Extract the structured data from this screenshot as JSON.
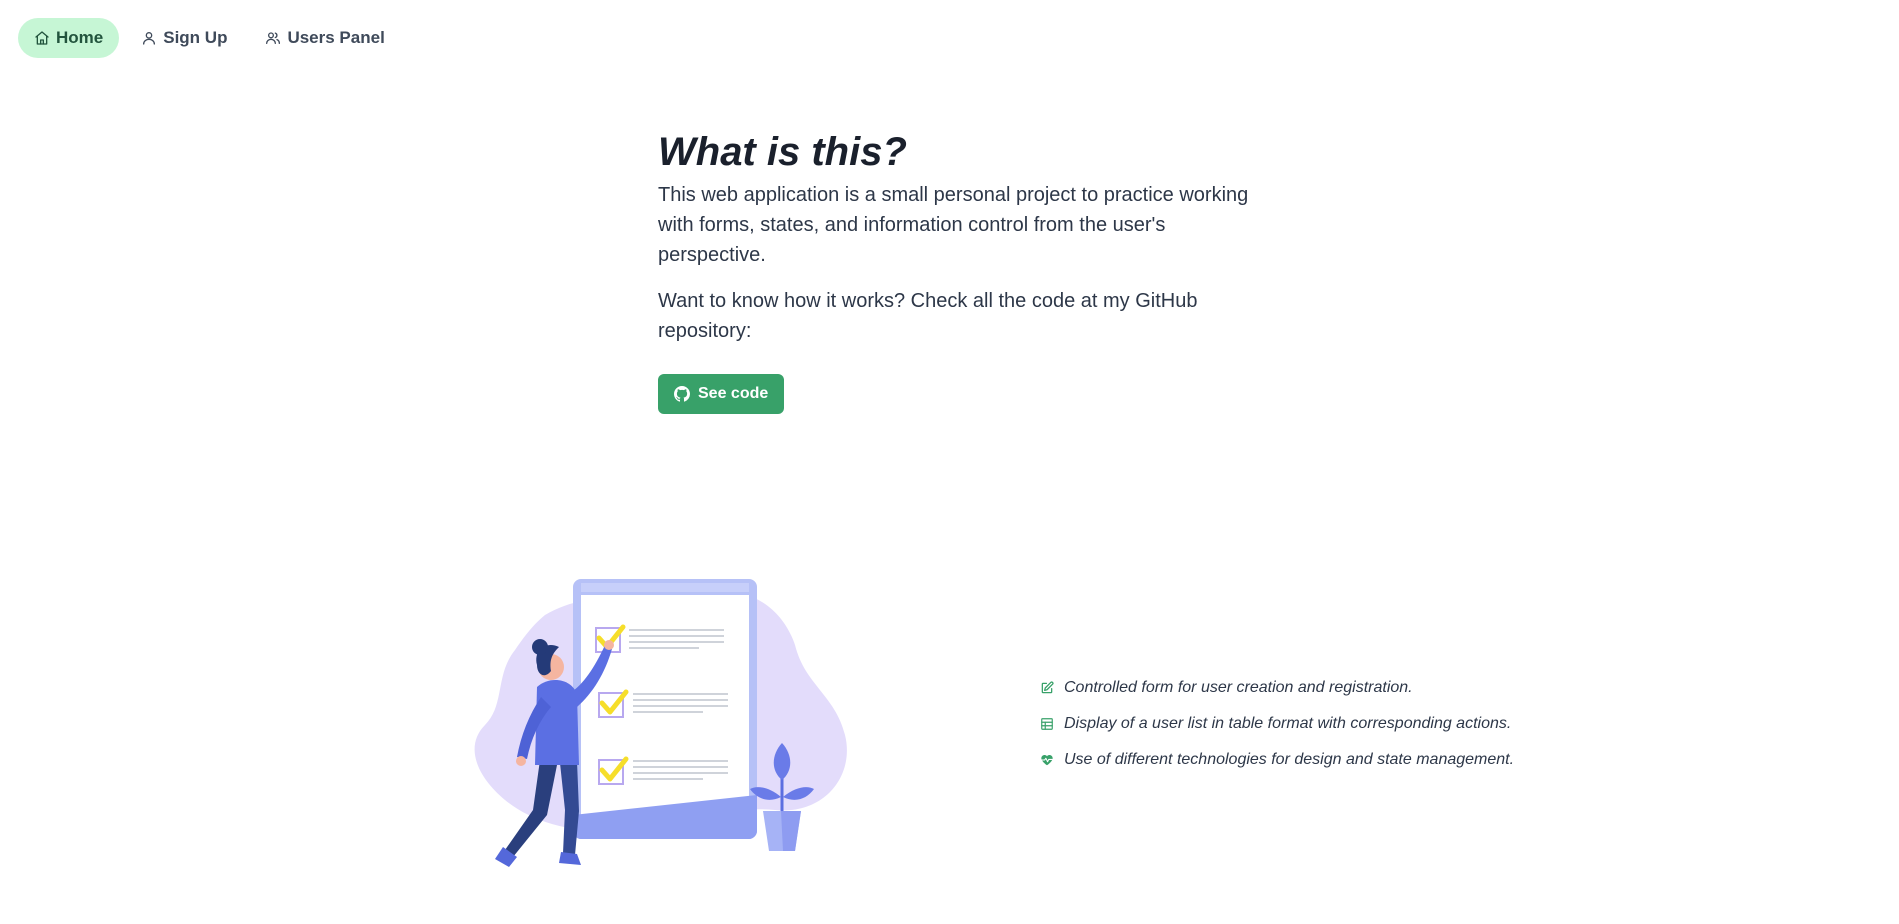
{
  "nav": {
    "items": [
      {
        "label": "Home",
        "icon": "home-icon",
        "active": true
      },
      {
        "label": "Sign Up",
        "icon": "user-icon",
        "active": false
      },
      {
        "label": "Users Panel",
        "icon": "users-icon",
        "active": false
      }
    ]
  },
  "intro": {
    "title": "What is this?",
    "paragraph1": "This web application is a small personal project to practice working with forms, states, and information control from the user's perspective.",
    "paragraph2": "Want to know how it works? Check all the code at my GitHub repository:",
    "button_label": "See code",
    "button_icon": "github-icon"
  },
  "features": [
    {
      "icon": "edit-icon",
      "text": "Controlled form for user creation and registration."
    },
    {
      "icon": "table-icon",
      "text": "Display of a user list in table format with corresponding actions."
    },
    {
      "icon": "heart-icon",
      "text": "Use of different technologies for design and state management."
    }
  ],
  "colors": {
    "accent": "#38a169",
    "nav_active_bg": "#c6f6d5",
    "nav_active_text": "#22543d",
    "text": "#2d3748"
  }
}
